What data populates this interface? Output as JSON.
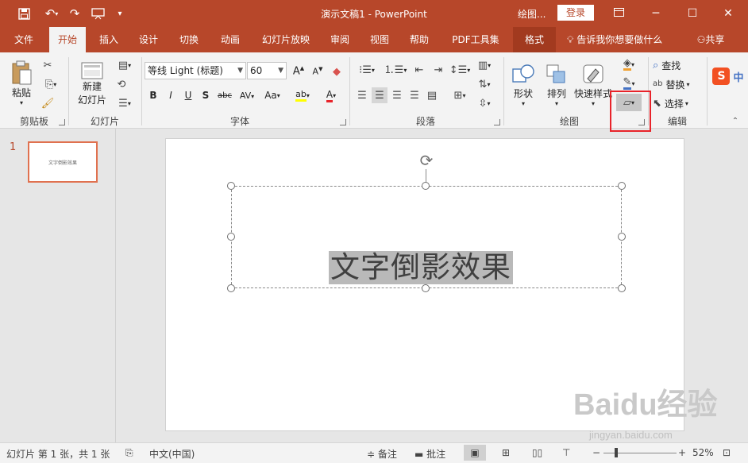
{
  "titlebar": {
    "title": "演示文稿1  -  PowerPoint",
    "drawing_tools": "绘图...",
    "login": "登录"
  },
  "tabs": [
    "文件",
    "开始",
    "插入",
    "设计",
    "切换",
    "动画",
    "幻灯片放映",
    "审阅",
    "视图",
    "帮助",
    "PDF工具集",
    "格式"
  ],
  "tell_me": "告诉我你想要做什么",
  "share": "共享",
  "ribbon": {
    "clipboard": {
      "paste": "粘贴",
      "label": "剪贴板"
    },
    "slides": {
      "new_line1": "新建",
      "new_line2": "幻灯片",
      "label": "幻灯片"
    },
    "font": {
      "name": "等线 Light (标题)",
      "size": "60",
      "label": "字体",
      "aa": "Aa"
    },
    "paragraph": {
      "label": "段落"
    },
    "drawing": {
      "shape": "形状",
      "arrange": "排列",
      "quick_styles": "快速样式",
      "label": "绘图"
    },
    "editing": {
      "find": "查找",
      "replace": "替换",
      "select": "选择",
      "label": "编辑"
    }
  },
  "slide_panel": {
    "number": "1",
    "thumb_text": "文字倒影效果"
  },
  "slide": {
    "text": "文字倒影效果"
  },
  "watermark": {
    "brand": "Baidu经验",
    "url": "jingyan.baidu.com"
  },
  "statusbar": {
    "slide_info": "幻灯片 第 1 张，共 1 张",
    "language": "中文(中国)",
    "notes": "备注",
    "comments": "批注",
    "zoom": "52%"
  },
  "colors": {
    "accent": "#b7472a",
    "highlight": "#e8232a",
    "selection_bg": "#b9b9b9"
  }
}
